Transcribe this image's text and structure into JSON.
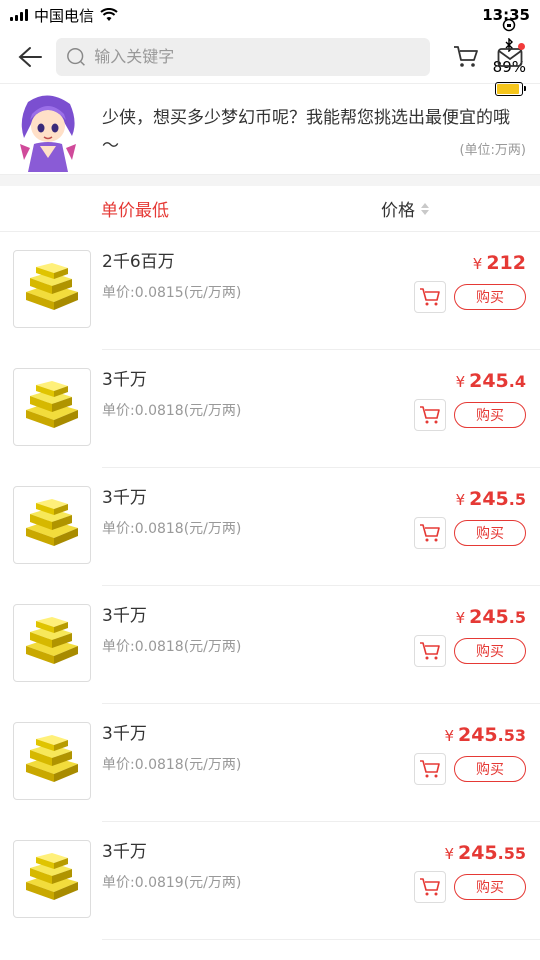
{
  "status_bar": {
    "carrier": "中国电信",
    "time": "13:35",
    "battery": "89%",
    "battery_level": 0.89
  },
  "search": {
    "placeholder": "输入关键字"
  },
  "banner": {
    "message": "少侠，想买多少梦幻币呢？我能帮您挑选出最便宜的哦～",
    "unit": "(单位:万两)"
  },
  "sort": {
    "lowest_unit_price": "单价最低",
    "price": "价格"
  },
  "items": [
    {
      "title": "2千6百万",
      "unit_price": "单价:0.0815(元/万两)",
      "yen": "¥",
      "price_int": "212",
      "price_dec": "",
      "buy": "购买"
    },
    {
      "title": "3千万",
      "unit_price": "单价:0.0818(元/万两)",
      "yen": "¥",
      "price_int": "245",
      "price_dec": ".4",
      "buy": "购买"
    },
    {
      "title": "3千万",
      "unit_price": "单价:0.0818(元/万两)",
      "yen": "¥",
      "price_int": "245",
      "price_dec": ".5",
      "buy": "购买"
    },
    {
      "title": "3千万",
      "unit_price": "单价:0.0818(元/万两)",
      "yen": "¥",
      "price_int": "245",
      "price_dec": ".5",
      "buy": "购买"
    },
    {
      "title": "3千万",
      "unit_price": "单价:0.0818(元/万两)",
      "yen": "¥",
      "price_int": "245",
      "price_dec": ".53",
      "buy": "购买"
    },
    {
      "title": "3千万",
      "unit_price": "单价:0.0819(元/万两)",
      "yen": "¥",
      "price_int": "245",
      "price_dec": ".55",
      "buy": "购买"
    }
  ],
  "colors": {
    "accent": "#e53935",
    "gold": "#e6c213"
  }
}
